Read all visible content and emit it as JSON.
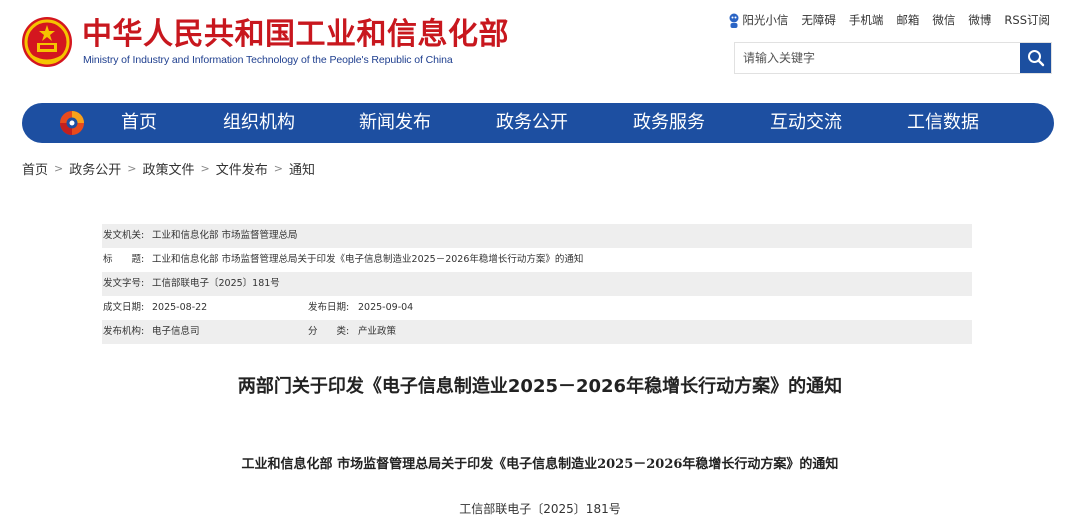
{
  "header": {
    "title": "中华人民共和国工业和信息化部",
    "subtitle": "Ministry of Industry and Information Technology of the People's Republic of China",
    "top_links": [
      "阳光小信",
      "无障碍",
      "手机端",
      "邮箱",
      "微信",
      "微博",
      "RSS订阅"
    ],
    "search_placeholder": "请输入关键字"
  },
  "nav": {
    "items": [
      "首页",
      "组织机构",
      "新闻发布",
      "政务公开",
      "政务服务",
      "互动交流",
      "工信数据"
    ]
  },
  "breadcrumb": [
    "首页",
    "政务公开",
    "政策文件",
    "文件发布",
    "通知"
  ],
  "meta": {
    "issuer_label": "发文机关:",
    "issuer": "工业和信息化部 市场监督管理总局",
    "title_label": "标　　题:",
    "title": "工业和信息化部 市场监督管理总局关于印发《电子信息制造业2025－2026年稳增长行动方案》的通知",
    "doc_no_label": "发文字号:",
    "doc_no": "工信部联电子〔2025〕181号",
    "date_written_label": "成文日期:",
    "date_written": "2025-08-22",
    "date_published_label": "发布日期:",
    "date_published": "2025-09-04",
    "agency_label": "发布机构:",
    "agency": "电子信息司",
    "category_label": "分　　类:",
    "category": "产业政策"
  },
  "article": {
    "title": "两部门关于印发《电子信息制造业2025－2026年稳增长行动方案》的通知",
    "subtitle": "工业和信息化部 市场监督管理总局关于印发《电子信息制造业2025－2026年稳增长行动方案》的通知",
    "doc_number": "工信部联电子〔2025〕181号"
  },
  "colors": {
    "brand_red": "#c8171e",
    "nav_blue": "#1d4fa1",
    "meta_row_alt": "#eeeeee"
  }
}
